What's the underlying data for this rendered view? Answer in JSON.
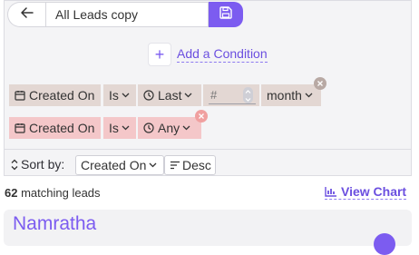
{
  "header": {
    "list_name": "All Leads copy"
  },
  "add_condition": {
    "label": "Add a Condition",
    "plus": "+"
  },
  "conditions": [
    {
      "field": "Created On",
      "operator": "Is",
      "range": "Last",
      "number_placeholder": "#",
      "unit": "month"
    },
    {
      "field": "Created On",
      "operator": "Is",
      "range": "Any"
    }
  ],
  "sort": {
    "label": "Sort by:",
    "field": "Created On",
    "direction": "Desc"
  },
  "results": {
    "count": "62",
    "count_suffix": "matching leads",
    "view_chart_label": "View Chart"
  },
  "leads": [
    {
      "name": "Namratha"
    }
  ],
  "colors": {
    "accent": "#7c5cf0",
    "condition_row_1": "#e3d7d3",
    "condition_row_2": "#f4c7c9",
    "remove_button": "#f0a0a0"
  }
}
